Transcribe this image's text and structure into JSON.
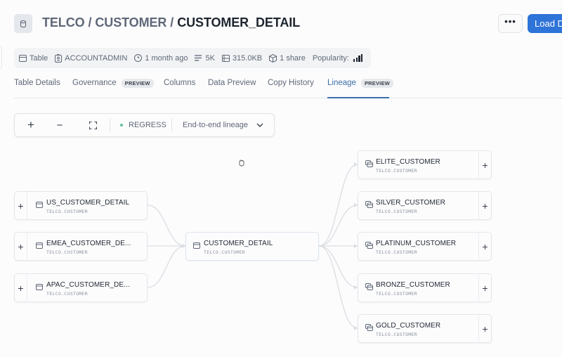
{
  "header": {
    "breadcrumb": [
      "TELCO",
      "CUSTOMER"
    ],
    "separator": "/",
    "current": "CUSTOMER_DETAIL",
    "more_label": "•••",
    "load_label": "Load Data",
    "icon": "database-icon",
    "accent_color": "#2f74d8"
  },
  "meta": {
    "type": "Table",
    "owner": "ACCOUNTADMIN",
    "updated": "1 month ago",
    "rows": "5K",
    "size": "315.0KB",
    "shares": "1 share",
    "popularity_label": "Popularity:",
    "popularity_level": "4 of 4"
  },
  "tabs": [
    {
      "label": "Table Details"
    },
    {
      "label": "Governance",
      "badge": "PREVIEW"
    },
    {
      "label": "Columns"
    },
    {
      "label": "Data Preview"
    },
    {
      "label": "Copy History"
    },
    {
      "label": "Lineage",
      "badge": "PREVIEW",
      "active": true
    }
  ],
  "toolbar": {
    "zoom_in": "+",
    "zoom_out": "−",
    "fit": "fit-screen-icon",
    "environment": "REGRESS",
    "environment_color": "#5fbf9a",
    "mode": "End-to-end lineage"
  },
  "lineage": {
    "upstream": [
      {
        "name": "US_CUSTOMER_DETAIL",
        "schema": "TELCO.CUSTOMER"
      },
      {
        "name": "EMEA_CUSTOMER_DE...",
        "schema": "TELCO.CUSTOMER"
      },
      {
        "name": "APAC_CUSTOMER_DE...",
        "schema": "TELCO.CUSTOMER"
      }
    ],
    "center": {
      "name": "CUSTOMER_DETAIL",
      "schema": "TELCO.CUSTOMER"
    },
    "downstream": [
      {
        "name": "ELITE_CUSTOMER",
        "schema": "TELCO.CUSTOMER"
      },
      {
        "name": "SILVER_CUSTOMER",
        "schema": "TELCO.CUSTOMER"
      },
      {
        "name": "PLATINUM_CUSTOMER",
        "schema": "TELCO.CUSTOMER"
      },
      {
        "name": "BRONZE_CUSTOMER",
        "schema": "TELCO.CUSTOMER"
      },
      {
        "name": "GOLD_CUSTOMER",
        "schema": "TELCO.CUSTOMER"
      }
    ],
    "expand_label": "+"
  }
}
